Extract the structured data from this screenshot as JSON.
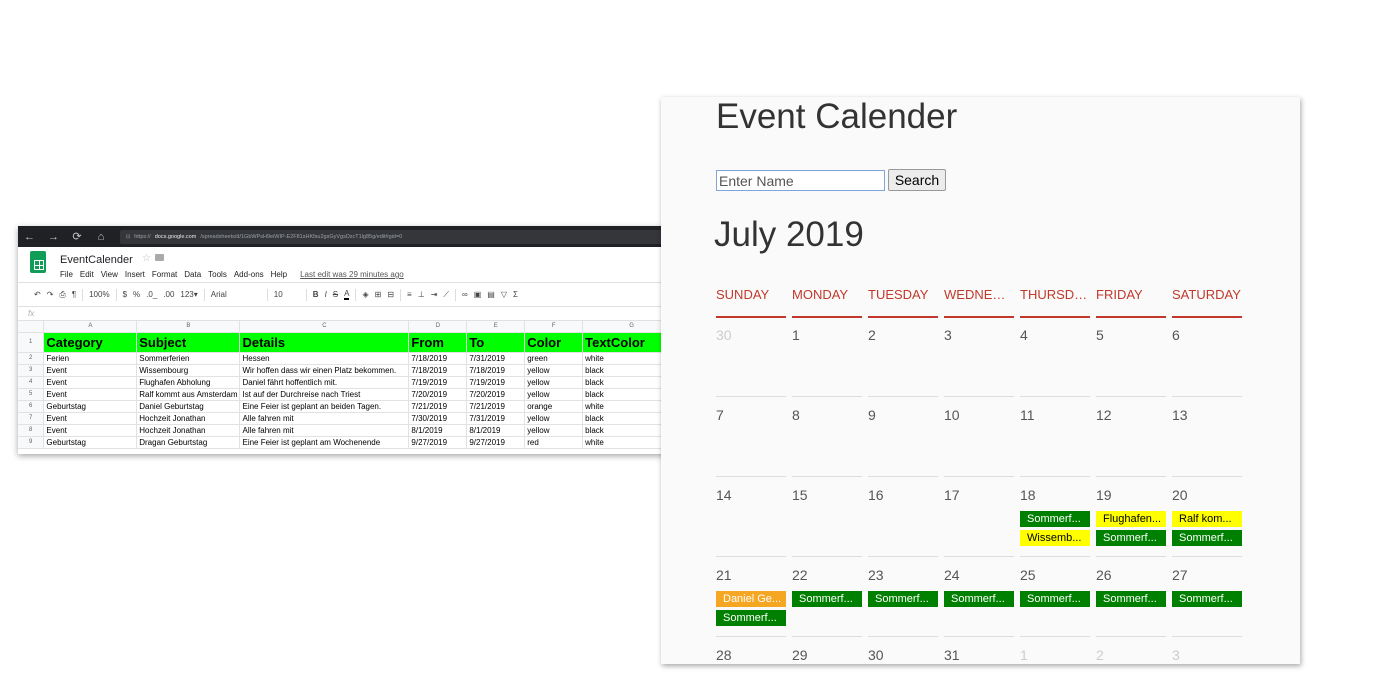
{
  "colors": {
    "green": "#008000",
    "yellow": "#ffff00",
    "orange": "#f5a623",
    "red": "#ff0000",
    "header_green": "#00ff00",
    "accent": "#c0392b"
  },
  "browser": {
    "back_icon": "←",
    "forward_icon": "→",
    "reload_icon": "⟳",
    "home_icon": "⌂",
    "lock_icon": "🔒",
    "url_prefix": "https://",
    "url_host": "docs.google.com",
    "url_path": "/spreadsheets/d/1GbWPsH9eiWIP-E2F81sHKfsu2gsGyVgsDzcT1lg85g/edit#gid=0"
  },
  "spreadsheet": {
    "title": "EventCalender",
    "star_icon": "☆",
    "folder_icon": "▪",
    "menu": [
      "File",
      "Edit",
      "View",
      "Insert",
      "Format",
      "Data",
      "Tools",
      "Add-ons",
      "Help"
    ],
    "last_edit": "Last edit was 29 minutes ago",
    "toolbar": {
      "zoom": "100%",
      "currency": "$",
      "percent": "%",
      "dec_less": ".0_",
      "dec_more": ".00",
      "format": "123▾",
      "font": "Arial",
      "size": "10",
      "bold": "B",
      "italic": "I",
      "strike": "S",
      "textcolor": "A",
      "sum": "Σ"
    },
    "fx": "fx",
    "columns": [
      "A",
      "B",
      "C",
      "D",
      "E",
      "F",
      "G"
    ],
    "header": [
      "Category",
      "Subject",
      "Details",
      "From",
      "To",
      "Color",
      "TextColor"
    ],
    "rows": [
      [
        "Ferien",
        "Sommerferien",
        "Hessen",
        "7/18/2019",
        "7/31/2019",
        "green",
        "white"
      ],
      [
        "Event",
        "Wissembourg",
        "Wir hoffen dass wir einen Platz bekommen.",
        "7/18/2019",
        "7/18/2019",
        "yellow",
        "black"
      ],
      [
        "Event",
        "Flughafen Abholung",
        "Daniel fährt hoffentlich mit.",
        "7/19/2019",
        "7/19/2019",
        "yellow",
        "black"
      ],
      [
        "Event",
        "Ralf kommt aus Amsterdam",
        "Ist auf der Durchreise nach Triest",
        "7/20/2019",
        "7/20/2019",
        "yellow",
        "black"
      ],
      [
        "Geburtstag",
        "Daniel Geburtstag",
        "Eine Feier ist geplant an beiden Tagen.",
        "7/21/2019",
        "7/21/2019",
        "orange",
        "white"
      ],
      [
        "Event",
        "Hochzeit Jonathan",
        "Alle fahren mit",
        "7/30/2019",
        "7/31/2019",
        "yellow",
        "black"
      ],
      [
        "Event",
        "Hochzeit Jonathan",
        "Alle fahren mit",
        "8/1/2019",
        "8/1/2019",
        "yellow",
        "black"
      ],
      [
        "Geburtstag",
        "Dragan Geburtstag",
        "Eine Feier ist geplant am Wochenende",
        "9/27/2019",
        "9/27/2019",
        "red",
        "white"
      ]
    ]
  },
  "calendar": {
    "title": "Event Calender",
    "search": {
      "placeholder": "Enter Name",
      "button": "Search"
    },
    "month": "July 2019",
    "weekdays": [
      "SUNDAY",
      "MONDAY",
      "TUESDAY",
      "WEDNESD...",
      "THURSDAY",
      "FRIDAY",
      "SATURDAY"
    ],
    "weeks": [
      [
        {
          "d": "30",
          "other": true
        },
        {
          "d": "1"
        },
        {
          "d": "2"
        },
        {
          "d": "3"
        },
        {
          "d": "4"
        },
        {
          "d": "5"
        },
        {
          "d": "6"
        }
      ],
      [
        {
          "d": "7"
        },
        {
          "d": "8"
        },
        {
          "d": "9"
        },
        {
          "d": "10"
        },
        {
          "d": "11"
        },
        {
          "d": "12"
        },
        {
          "d": "13"
        }
      ],
      [
        {
          "d": "14"
        },
        {
          "d": "15"
        },
        {
          "d": "16"
        },
        {
          "d": "17"
        },
        {
          "d": "18",
          "events": [
            {
              "label": "Sommerf...",
              "color": "green"
            },
            {
              "label": "Wissemb...",
              "color": "yellow"
            }
          ]
        },
        {
          "d": "19",
          "events": [
            {
              "label": "Flughafen...",
              "color": "yellow"
            },
            {
              "label": "Sommerf...",
              "color": "green"
            }
          ]
        },
        {
          "d": "20",
          "events": [
            {
              "label": "Ralf kom...",
              "color": "yellow"
            },
            {
              "label": "Sommerf...",
              "color": "green"
            }
          ]
        }
      ],
      [
        {
          "d": "21",
          "events": [
            {
              "label": "Daniel Ge...",
              "color": "orange"
            },
            {
              "label": "Sommerf...",
              "color": "green"
            }
          ]
        },
        {
          "d": "22",
          "events": [
            {
              "label": "Sommerf...",
              "color": "green"
            }
          ]
        },
        {
          "d": "23",
          "events": [
            {
              "label": "Sommerf...",
              "color": "green"
            }
          ]
        },
        {
          "d": "24",
          "events": [
            {
              "label": "Sommerf...",
              "color": "green"
            }
          ]
        },
        {
          "d": "25",
          "events": [
            {
              "label": "Sommerf...",
              "color": "green"
            }
          ]
        },
        {
          "d": "26",
          "events": [
            {
              "label": "Sommerf...",
              "color": "green"
            }
          ]
        },
        {
          "d": "27",
          "events": [
            {
              "label": "Sommerf...",
              "color": "green"
            }
          ]
        }
      ],
      [
        {
          "d": "28"
        },
        {
          "d": "29"
        },
        {
          "d": "30"
        },
        {
          "d": "31"
        },
        {
          "d": "1",
          "other": true
        },
        {
          "d": "2",
          "other": true
        },
        {
          "d": "3",
          "other": true
        }
      ]
    ]
  }
}
